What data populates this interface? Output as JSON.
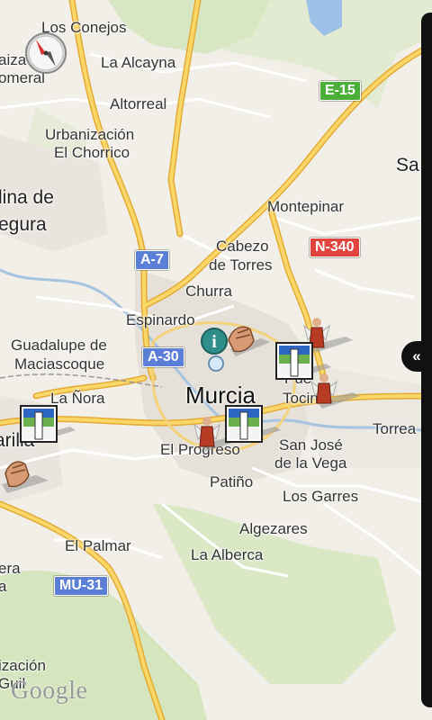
{
  "places": {
    "los_conejos": "Los Conejos",
    "zaraiche_part": "aiza",
    "romeral_part": "omeral",
    "la_alcayna": "La Alcayna",
    "altorreal": "Altorreal",
    "urbanizacion": "Urbanización",
    "el_chorrico": "El Chorrico",
    "molina_1": "lina de",
    "molina_2": "egura",
    "montepinar": "Montepinar",
    "cabezo_1": "Cabezo",
    "cabezo_2": "de Torres",
    "churra": "Churra",
    "espinardo": "Espinardo",
    "guadalupe_1": "Guadalupe de",
    "guadalupe_2": "Maciascoque",
    "la_nora": "La Ñora",
    "murcia": "Murcia",
    "puente_tocinos_1": "Pue",
    "puente_tocinos_2": "Tocin",
    "el_progreso": "El Progreso",
    "san_jose_1": "San José",
    "san_jose_2": "de la Vega",
    "torreagüera_part": "Torrea",
    "patino": "Patiño",
    "los_garres": "Los Garres",
    "javali_part": "arilla",
    "algezares": "Algezares",
    "el_palmar": "El Palmar",
    "la_alberca": "La Alberca",
    "sangonera_part_1": "era",
    "sangonera_part_2": "a",
    "santomera_part": "Sa",
    "urbanizacion_bottom_1": "ización",
    "urbanizacion_bottom_2": "Guil"
  },
  "roads": {
    "e15": "E-15",
    "a7": "A-7",
    "n340": "N-340",
    "a30": "A-30",
    "mu31": "MU-31"
  },
  "colors": {
    "motorway_shield_blue": "#5b7fd6",
    "european_shield_green": "#4caf3a",
    "national_shield_red": "#e0443c",
    "road_yellow": "#f8c54a",
    "road_white": "#ffffff",
    "park_green": "#cde3b4",
    "land": "#f2efe9",
    "urban": "#e8e4de",
    "info_teal": "#2e8f8a"
  },
  "map_ui": {
    "attribution": "Google",
    "panel_toggle_icon": "«"
  },
  "markers": [
    {
      "kind": "info-marker",
      "icon": "info-icon"
    },
    {
      "kind": "hand-marker",
      "icon": "hand-icon"
    },
    {
      "kind": "angel-marker",
      "icon": "angel-icon"
    },
    {
      "kind": "flag-marker",
      "icon": "flag-icon"
    }
  ]
}
